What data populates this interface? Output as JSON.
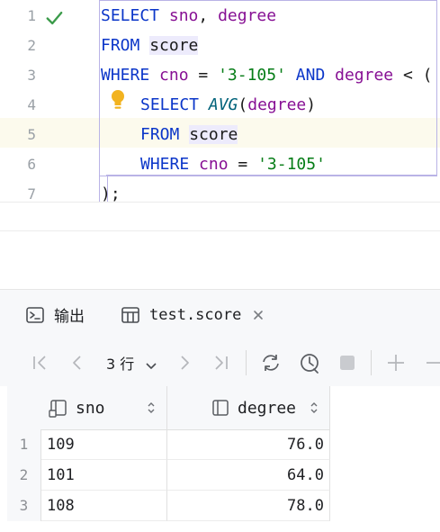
{
  "editor": {
    "line_numbers": [
      "1",
      "2",
      "3",
      "4",
      "5",
      "6",
      "7"
    ],
    "lines": [
      [
        {
          "t": "SELECT",
          "c": "kw"
        },
        {
          "t": " ",
          "c": ""
        },
        {
          "t": "sno",
          "c": "id"
        },
        {
          "t": ", ",
          "c": ""
        },
        {
          "t": "degree",
          "c": "id"
        }
      ],
      [
        {
          "t": "FROM",
          "c": "kw"
        },
        {
          "t": " ",
          "c": ""
        },
        {
          "t": "score",
          "c": "tbl"
        }
      ],
      [
        {
          "t": "WHERE",
          "c": "kw"
        },
        {
          "t": " ",
          "c": ""
        },
        {
          "t": "cno",
          "c": "id"
        },
        {
          "t": " = ",
          "c": ""
        },
        {
          "t": "'3-105'",
          "c": "str"
        },
        {
          "t": " ",
          "c": ""
        },
        {
          "t": "AND",
          "c": "kw"
        },
        {
          "t": " ",
          "c": ""
        },
        {
          "t": "degree",
          "c": "id"
        },
        {
          "t": " < (",
          "c": ""
        }
      ],
      [
        {
          "t": "SELECT",
          "c": "kw"
        },
        {
          "t": " ",
          "c": ""
        },
        {
          "t": "AVG",
          "c": "fn"
        },
        {
          "t": "(",
          "c": ""
        },
        {
          "t": "degree",
          "c": "id"
        },
        {
          "t": ")",
          "c": ""
        }
      ],
      [
        {
          "t": "FROM",
          "c": "kw"
        },
        {
          "t": " ",
          "c": ""
        },
        {
          "t": "score",
          "c": "tbl"
        }
      ],
      [
        {
          "t": "WHERE",
          "c": "kw"
        },
        {
          "t": " ",
          "c": ""
        },
        {
          "t": "cno",
          "c": "id"
        },
        {
          "t": " = ",
          "c": ""
        },
        {
          "t": "'3-105'",
          "c": "str"
        }
      ],
      [
        {
          "t": ");",
          "c": ""
        }
      ]
    ]
  },
  "tabs": {
    "output_label": "输出",
    "result_label": "test.score"
  },
  "toolbar": {
    "row_count": "3 行"
  },
  "grid": {
    "columns": [
      "sno",
      "degree"
    ],
    "rows": [
      {
        "num": "1",
        "sno": "109",
        "degree": "76.0"
      },
      {
        "num": "2",
        "sno": "101",
        "degree": "64.0"
      },
      {
        "num": "3",
        "sno": "108",
        "degree": "78.0"
      }
    ]
  },
  "colors": {
    "keyword": "#0b36c9",
    "identifier": "#871094",
    "string": "#067d17",
    "function": "#00627a",
    "check": "#3b9b4a",
    "bulb": "#f2b320"
  }
}
